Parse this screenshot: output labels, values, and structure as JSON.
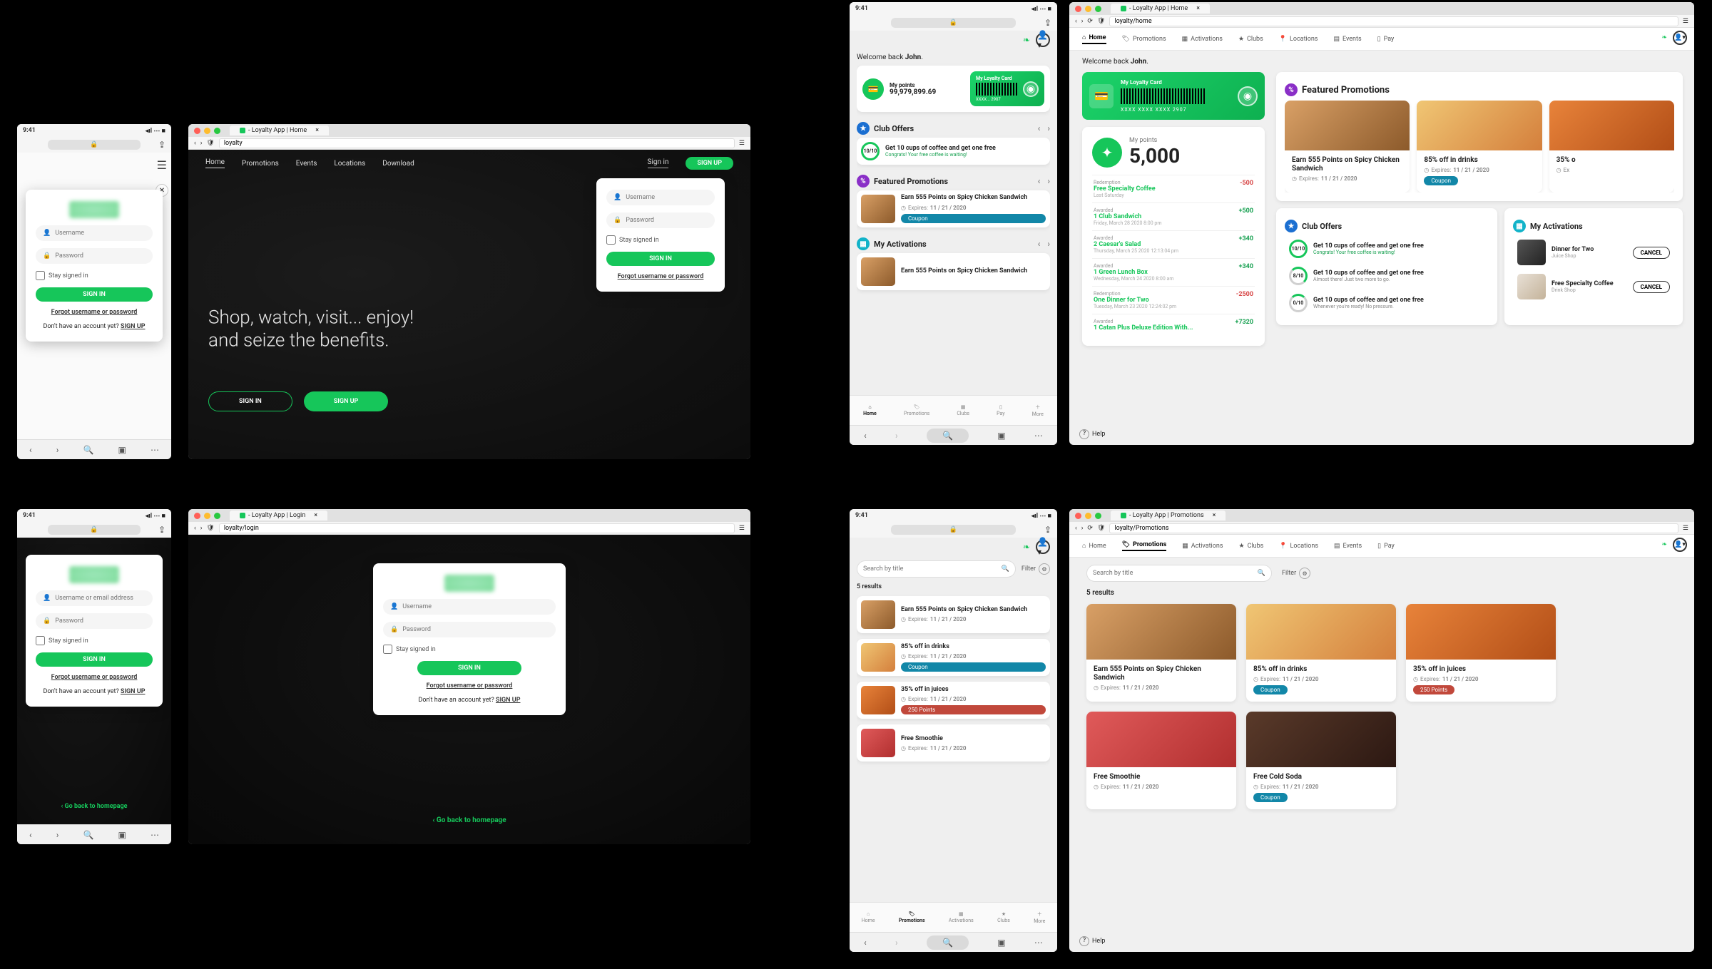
{
  "ios_status_time": "9:41",
  "signin_label": "SIGN IN",
  "signup_label": "SIGN UP",
  "signin_title": "Sign in",
  "username_ph": "Username",
  "username_email_ph": "Username or email address",
  "password_ph": "Password",
  "stay_signed": "Stay signed in",
  "forgot": "Forgot username or password",
  "noacct_prefix": "Don't have an account yet? ",
  "noacct_link": "SIGN UP",
  "back_home": "Go back to homepage",
  "hero_tagline": "Shop, watch, visit... enjoy! and seize the benefits.",
  "nav": {
    "home": "Home",
    "promotions": "Promotions",
    "events": "Events",
    "locations": "Locations",
    "download": "Download",
    "activations": "Activations",
    "clubs": "Clubs",
    "pay": "Pay"
  },
  "browser": {
    "tab_home": "- Loyalty App | Home",
    "tab_login": "- Loyalty App | Login",
    "tab_promos": "- Loyalty App | Promotions",
    "url_home": "loyalty",
    "url_home2": "loyalty/home",
    "url_login": "loyalty/login",
    "url_promos": "loyalty/Promotions"
  },
  "dash": {
    "welcome_prefix": "Welcome back ",
    "welcome_name": "John",
    "welcome_suffix": ".",
    "mypoints_label": "My points",
    "points_small": "99,979,899.69",
    "points_big": "5,000",
    "card_label": "My Loyalty Card",
    "card_masked": "XXXX... 2907",
    "card_full": "XXXX  XXXX  XXXX  2907",
    "sections": {
      "clubs": "Club Offers",
      "promos": "Featured Promotions",
      "acts": "My Activations"
    },
    "offer_full": {
      "title": "Get 10 cups of coffee and get one free",
      "sub": "Congrats! Your free coffee is waiting!",
      "ring": "10/10"
    },
    "offer_mid": {
      "title": "Get 10 cups of coffee and get one free",
      "sub": "Almost there! Just two more to go.",
      "ring": "8/10"
    },
    "offer_low": {
      "title": "Get 10 cups of coffee and get one free",
      "sub": "Whenever you're ready! No pressure.",
      "ring": "0/10"
    },
    "redemption_label": "Redemption",
    "awarded_label": "Awarded",
    "txns": [
      {
        "kind": "Redemption",
        "title": "Free Specialty Coffee",
        "when": "Last Saturday",
        "amt": "-500",
        "neg": true
      },
      {
        "kind": "Awarded",
        "title": "1 Club Sandwich",
        "when": "Friday, March 28 2020 8:00 pm",
        "amt": "+500",
        "neg": false
      },
      {
        "kind": "Awarded",
        "title": "2 Caesar's Salad",
        "when": "Thursday, March 25 2020 12:13:04 pm",
        "amt": "+340",
        "neg": false
      },
      {
        "kind": "Awarded",
        "title": "1 Green Lunch Box",
        "when": "Wednesday, March 24 2020 8:00 am",
        "amt": "+340",
        "neg": false
      },
      {
        "kind": "Redemption",
        "title": "One Dinner for Two",
        "when": "Tuesday, March 23 2020 12:24:02 pm",
        "amt": "-2500",
        "neg": true
      },
      {
        "kind": "Awarded",
        "title": "1 Catan Plus Deluxe Edition With...",
        "when": "",
        "amt": "+7320",
        "neg": false
      }
    ],
    "acts": [
      {
        "title": "Dinner for Two",
        "sub": "Juice Shop"
      },
      {
        "title": "Free Specialty Coffee",
        "sub": "Drink Shop"
      }
    ],
    "cancel": "CANCEL",
    "tabbar": {
      "home": "Home",
      "promos": "Promotions",
      "acts": "Activations",
      "clubs": "Clubs",
      "pay": "Pay",
      "more": "More"
    }
  },
  "promos": {
    "title1": "Earn 555 Points on Spicy Chicken Sandwich",
    "title2": "85% off in drinks",
    "title3": "35% off in juices",
    "title4": "Free Smoothie",
    "title5": "Free Cold Soda",
    "title3_short": "35% o",
    "expires_label": "Expires:",
    "expires_date": "11 / 21 / 2020",
    "coupon": "Coupon",
    "points250": "250 Points"
  },
  "search": {
    "ph": "Search by title",
    "filter": "Filter",
    "results": "5 results"
  },
  "help": "Help"
}
